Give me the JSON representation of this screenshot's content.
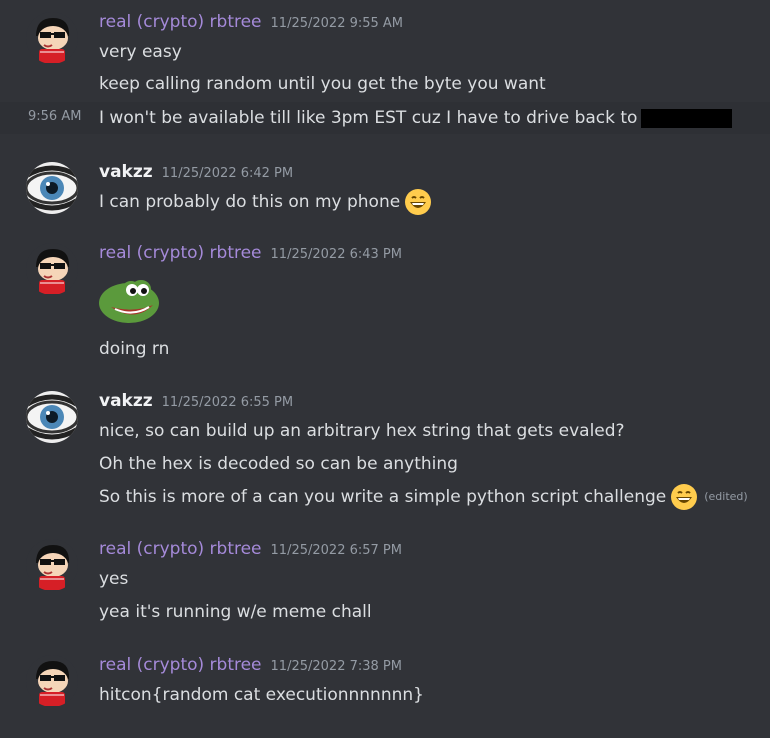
{
  "users": {
    "rbtree": "real (crypto) rbtree",
    "vakzz": "vakzz"
  },
  "groups": [
    {
      "author": "real (crypto) rbtree",
      "timestamp": "11/25/2022 9:55 AM",
      "lines": [
        "very easy",
        "keep calling random until you get the byte you want",
        "I won't be available till like 3pm EST cuz I have to drive back to"
      ],
      "side_timestamp": "9:56 AM"
    },
    {
      "author": "vakzz",
      "timestamp": "11/25/2022 6:42 PM",
      "lines": [
        "I can probably do this on my phone"
      ]
    },
    {
      "author": "real (crypto) rbtree",
      "timestamp": "11/25/2022 6:43 PM",
      "lines": [
        "doing rn"
      ]
    },
    {
      "author": "vakzz",
      "timestamp": "11/25/2022 6:55 PM",
      "lines": [
        "nice, so can build up an arbitrary hex string that gets evaled?",
        "Oh the hex is decoded so can be anything",
        "So this is more of a can you write a simple python script challenge"
      ],
      "edited": "(edited)"
    },
    {
      "author": "real (crypto) rbtree",
      "timestamp": "11/25/2022 6:57 PM",
      "lines": [
        "yes",
        "yea it's running w/e meme chall"
      ]
    },
    {
      "author": "real (crypto) rbtree",
      "timestamp": "11/25/2022 7:38 PM",
      "lines": [
        "hitcon{random cat executionnnnnnn}"
      ]
    }
  ],
  "colors": {
    "background": "#313338",
    "rbtree_name": "#a58ad9",
    "vakzz_name": "#f2f3f5",
    "text": "#dbdee1",
    "timestamp": "#949ba4"
  }
}
